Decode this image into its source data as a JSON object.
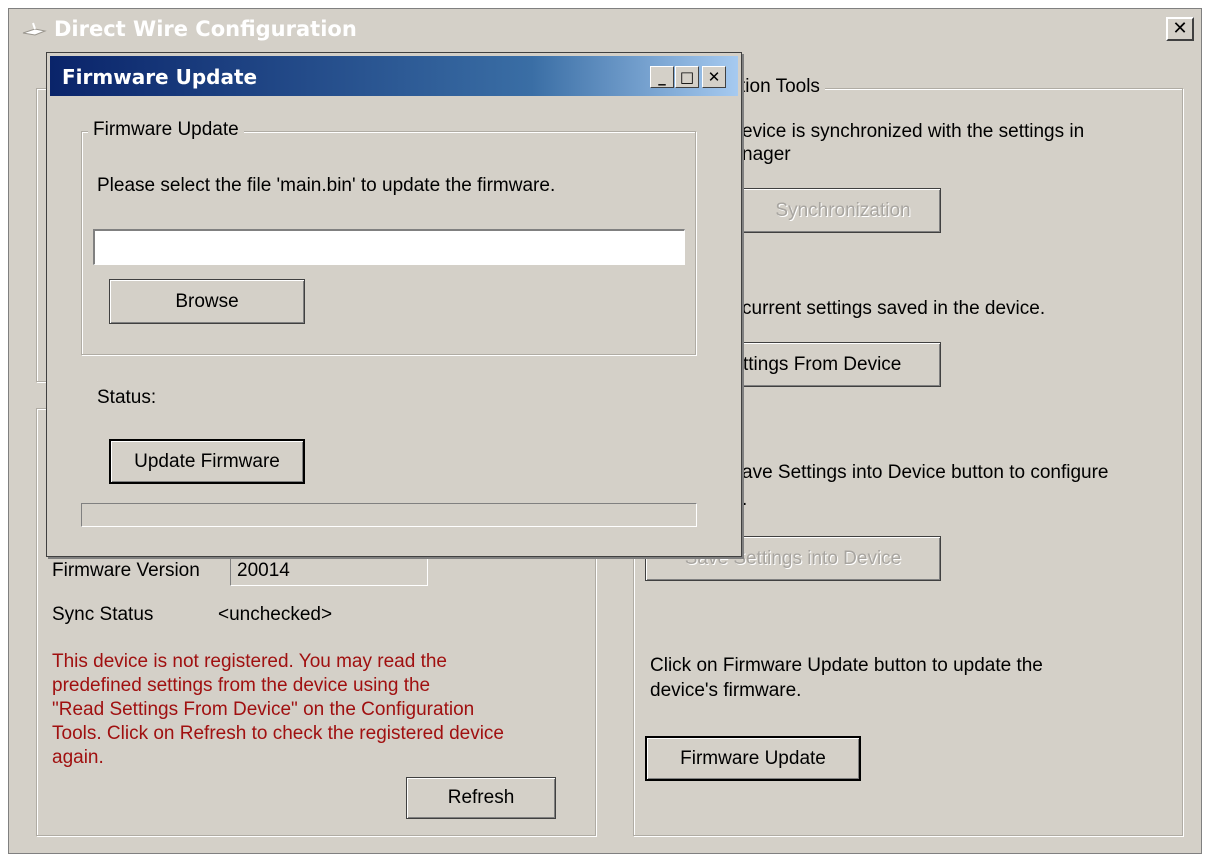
{
  "main_window": {
    "title": "Direct Wire Configuration",
    "close_glyph": "✕"
  },
  "config_tools": {
    "group_label": "tion Tools",
    "sync_desc_line1": "evice is synchronized with the settings in",
    "sync_desc_line2": "nager",
    "sync_button": "Synchronization",
    "read_desc": "current settings saved in the device.",
    "read_button": "ttings From Device",
    "save_desc_line1": "ave Settings into Device button to configure",
    "save_desc_line2": ".",
    "save_button": "Save Settings into Device",
    "fw_desc_line1": "Click on Firmware Update button to update the",
    "fw_desc_line2": "device's firmware.",
    "fw_button": "Firmware Update"
  },
  "device_info": {
    "fw_version_label": "Firmware Version",
    "fw_version_value": "20014",
    "sync_status_label": "Sync Status",
    "sync_status_value": "<unchecked>",
    "warning_lines": [
      "This device is not registered. You may read the",
      "predefined settings from the device using the",
      "\"Read Settings From Device\" on the Configuration",
      "Tools. Click on Refresh to check the registered device",
      "again."
    ],
    "refresh_button": "Refresh"
  },
  "firmware_dialog": {
    "title": "Firmware Update",
    "minimize_glyph": "_",
    "maximize_glyph": "□",
    "close_glyph": "✕",
    "group_label": "Firmware Update",
    "instruction": "Please select the file 'main.bin' to update the firmware.",
    "file_path_value": "",
    "browse_button": "Browse",
    "status_label": "Status:",
    "update_button": "Update Firmware",
    "progress_fraction": 0
  },
  "colors": {
    "window_bg": "#d4d0c8",
    "warning_text": "#a01010",
    "title_bar_start": "#0a246a"
  }
}
